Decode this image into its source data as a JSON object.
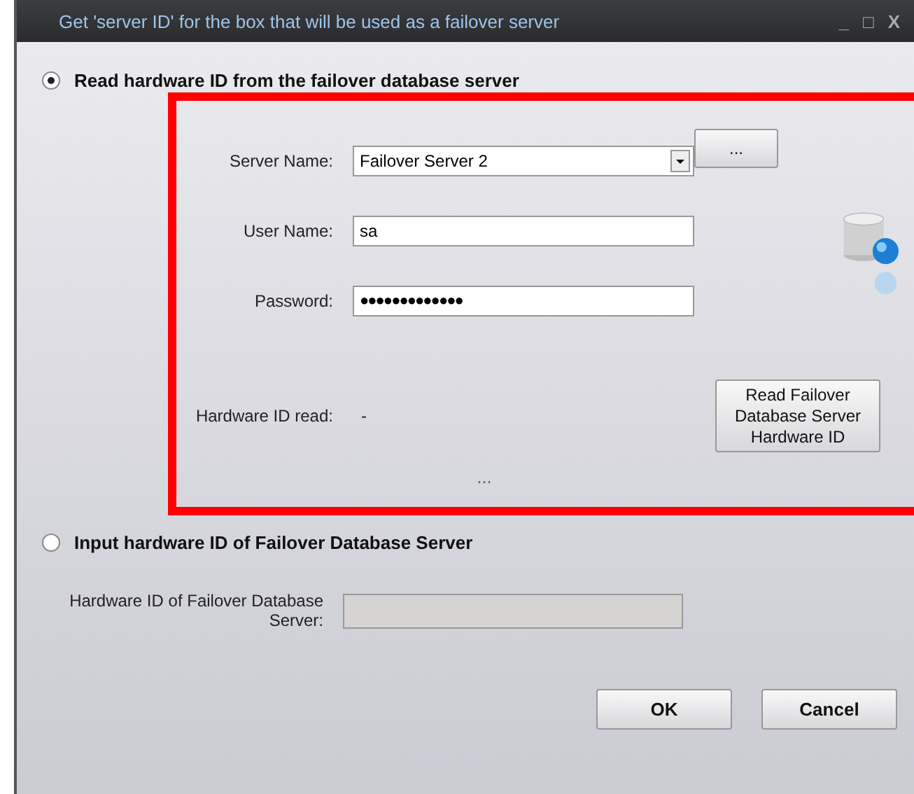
{
  "window": {
    "title": "Get 'server ID' for the box that will be used as a failover server",
    "controls": [
      "_",
      "□",
      "X"
    ]
  },
  "options": [
    {
      "label": "Read hardware ID from the failover database server",
      "selected": true
    },
    {
      "label": "Input hardware ID of Failover Database Server",
      "selected": false
    }
  ],
  "read_panel": {
    "highlighted": true,
    "server_name": {
      "label": "Server Name:",
      "value": "Failover Server 2"
    },
    "browse_button": "...",
    "user_name": {
      "label": "User Name:",
      "value": "sa"
    },
    "password": {
      "label": "Password:",
      "value": "●●●●●●●●●●●●●"
    },
    "hardware_id_read": {
      "label": "Hardware ID read:",
      "value": "-"
    },
    "read_button": "Read Failover Database Server Hardware ID",
    "status": "..."
  },
  "input_panel": {
    "label": "Hardware ID of Failover Database Server:",
    "disabled": true
  },
  "buttons": [
    "OK",
    "Cancel"
  ]
}
